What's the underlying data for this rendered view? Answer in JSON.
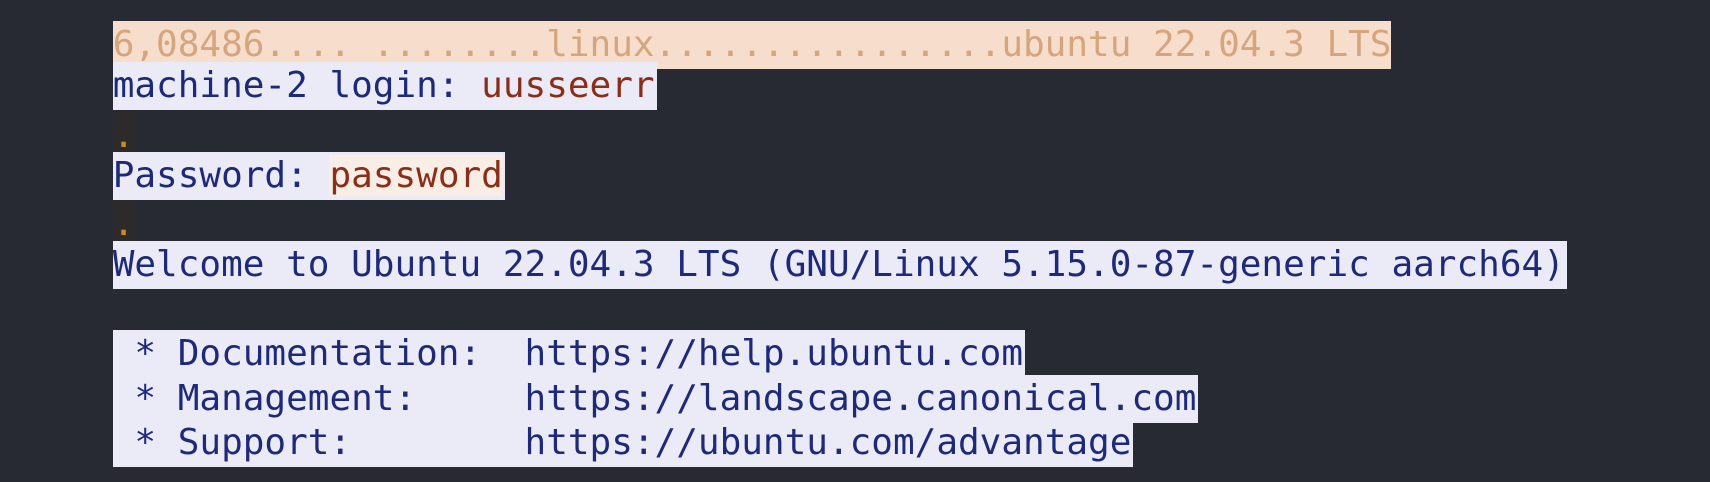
{
  "terminal": {
    "top_partial": "6,08486.... ........linux................ubuntu 22.04.3 LTS",
    "login_prompt": "machine-2 login: ",
    "login_value": "uusseerr",
    "echo_dot_1": ".",
    "password_prompt": "Password: ",
    "password_value": "password",
    "echo_dot_2": ".",
    "welcome": "Welcome to Ubuntu 22.04.3 LTS (GNU/Linux 5.15.0-87-generic aarch64)",
    "links": [
      {
        "label": " * Documentation:  ",
        "url": "https://help.ubuntu.com"
      },
      {
        "label": " * Management:     ",
        "url": "https://landscape.canonical.com"
      },
      {
        "label": " * Support:        ",
        "url": "https://ubuntu.com/advantage"
      }
    ]
  }
}
